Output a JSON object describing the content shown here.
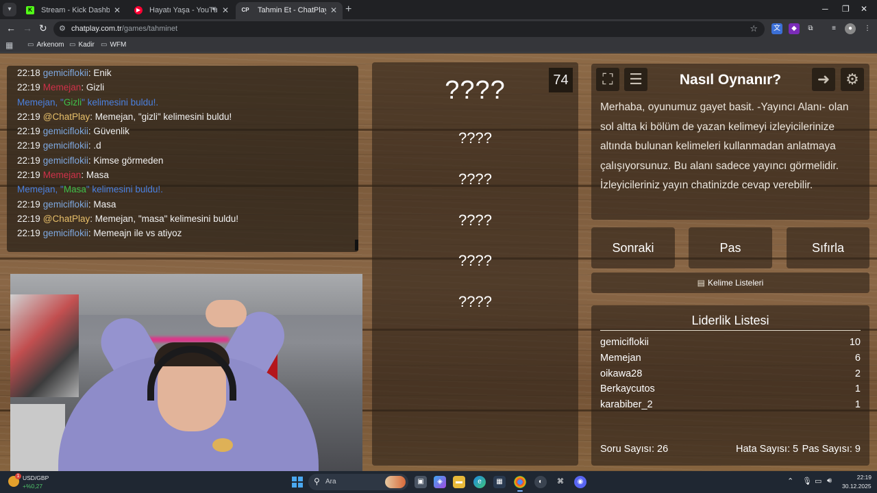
{
  "browser": {
    "tabs": [
      {
        "title": "Stream - Kick Dashboard",
        "favicon_color": "#53fc18",
        "favicon_glyph": "K"
      },
      {
        "title": "Hayatı Yaşa - YouTube Music",
        "favicon_color": "#ff0033",
        "favicon_glyph": "▶"
      },
      {
        "title": "Tahmin Et - ChatPlay",
        "favicon_color": "#35363a",
        "favicon_glyph": "CP"
      }
    ],
    "url_host": "chatplay.com.tr",
    "url_path": "/games/tahminet",
    "bookmarks": [
      "Arkenom",
      "Kadir",
      "WFM"
    ]
  },
  "chat": {
    "lines": [
      {
        "time": "22:18",
        "user": "gemiciflokii",
        "user_color": "blue",
        "message": "Enik"
      },
      {
        "time": "22:19",
        "user": "Memejan",
        "user_color": "red",
        "message": "Gizli"
      },
      {
        "system": true,
        "pre": "Memejan, \"",
        "word": "Gizli",
        "post": "\" kelimesini buldu!."
      },
      {
        "time": "22:19",
        "user": "@ChatPlay",
        "user_color": "gold",
        "message": "Memejan, \"gizli\" kelimesini buldu!"
      },
      {
        "time": "22:19",
        "user": "gemiciflokii",
        "user_color": "blue",
        "message": "Güvenlik"
      },
      {
        "time": "22:19",
        "user": "gemiciflokii",
        "user_color": "blue",
        "message": ".d"
      },
      {
        "time": "22:19",
        "user": "gemiciflokii",
        "user_color": "blue",
        "message": "Kimse görmeden"
      },
      {
        "time": "22:19",
        "user": "Memejan",
        "user_color": "red",
        "message": "Masa"
      },
      {
        "system": true,
        "pre": "Memejan, \"",
        "word": "Masa",
        "post": "\" kelimesini buldu!."
      },
      {
        "time": "22:19",
        "user": "gemiciflokii",
        "user_color": "blue",
        "message": "Masa"
      },
      {
        "time": "22:19",
        "user": "@ChatPlay",
        "user_color": "gold",
        "message": "Memejan, \"masa\" kelimesini buldu!"
      },
      {
        "time": "22:19",
        "user": "gemiciflokii",
        "user_color": "blue",
        "message": "Memeajn ile vs atiyoz"
      }
    ]
  },
  "game": {
    "timer": "74",
    "main_word": "????",
    "forbidden_words": [
      "????",
      "????",
      "????",
      "????",
      "????"
    ]
  },
  "howto": {
    "title": "Nasıl Oynanır?",
    "text": "Merhaba, oyunumuz gayet basit. -Yayıncı Alanı- olan sol altta ki bölüm de yazan kelimeyi izleyicilerinize altında bulunan kelimeleri kullanmadan anlatmaya çalışıyorsunuz. Bu alanı sadece yayıncı görmelidir. İzleyicileriniz yayın chatinizde cevap verebilir."
  },
  "actions": {
    "next": "Sonraki",
    "pass": "Pas",
    "reset": "Sıfırla",
    "word_lists": "Kelime Listeleri"
  },
  "leaderboard": {
    "title": "Liderlik Listesi",
    "rows": [
      {
        "name": "gemiciflokii",
        "score": "10"
      },
      {
        "name": "Memejan",
        "score": "6"
      },
      {
        "name": "oikawa28",
        "score": "2"
      },
      {
        "name": "Berkaycutos",
        "score": "1"
      },
      {
        "name": "karabiber_2",
        "score": "1"
      }
    ],
    "question_count": "Soru Sayısı: 26",
    "error_count": "Hata Sayısı: 5",
    "pass_count": "Pas Sayısı: 9"
  },
  "taskbar": {
    "weather_badge": "1",
    "ticker_name": "USD/GBP",
    "ticker_change": "+%0,27",
    "search_placeholder": "Ara",
    "time": "22:19",
    "date": "30.12.2025"
  },
  "colors": {
    "chat_user_blue": "#7ea8e0",
    "chat_user_red": "#d0314a",
    "chat_user_gold": "#e8c06a",
    "system_message": "#4a80e0",
    "system_word": "#3fbf4a"
  }
}
